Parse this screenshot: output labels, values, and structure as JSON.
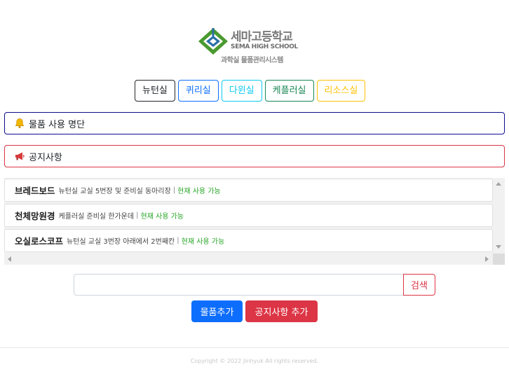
{
  "header": {
    "school_name_ko": "세마고등학교",
    "school_name_en": "SEMA HIGH SCHOOL",
    "system_name": "과학실 물품관리시스템",
    "brand_colors": {
      "green": "#4a9a2f",
      "blue": "#2a6ea8"
    }
  },
  "labs": [
    {
      "label": "뉴턴실",
      "color": "#212529"
    },
    {
      "label": "퀴리실",
      "color": "#0d6efd"
    },
    {
      "label": "다윈실",
      "color": "#0dcaf0"
    },
    {
      "label": "케플러실",
      "color": "#198754"
    },
    {
      "label": "리소스실",
      "color": "#ffc107"
    }
  ],
  "notices": {
    "usage_list": {
      "label": "물품 사용 명단",
      "icon": "bell-icon",
      "border_color": "#0d0d8f"
    },
    "announcements": {
      "label": "공지사항",
      "icon": "megaphone-icon",
      "border_color": "#dc3545"
    }
  },
  "items": [
    {
      "name": "브레드보드",
      "location": "뉴턴실 교실 5번장 및 준비실 동아리장",
      "separator": "|",
      "status": "현재 사용 가능"
    },
    {
      "name": "천체망원경",
      "location": "케플러실 준비실 한가운데",
      "separator": "|",
      "status": "현재 사용 가능"
    },
    {
      "name": "오실로스코프",
      "location": "뉴턴실 교실 3번장 아래에서 2번째칸",
      "separator": "|",
      "status": "현재 사용 가능"
    }
  ],
  "search": {
    "value": "",
    "placeholder": "",
    "button_label": "검색"
  },
  "actions": {
    "add_item_label": "물품추가",
    "add_notice_label": "공지사항 추가"
  },
  "footer": {
    "copyright": "Copyright © 2022 Jinhyuk All rights reserved."
  },
  "status_color": "#25a425"
}
